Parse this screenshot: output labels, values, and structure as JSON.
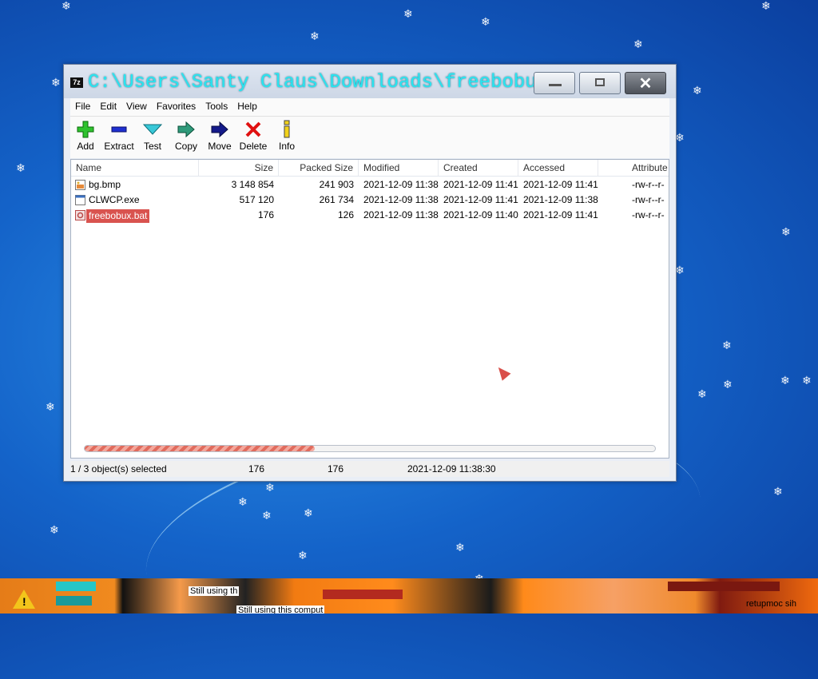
{
  "window": {
    "title": "C:\\Users\\Santy Claus\\Downloads\\freebobux-...",
    "app_icon_text": "7z"
  },
  "menu": [
    "File",
    "Edit",
    "View",
    "Favorites",
    "Tools",
    "Help"
  ],
  "toolbar": {
    "add": "Add",
    "extract": "Extract",
    "test": "Test",
    "copy": "Copy",
    "move": "Move",
    "delete": "Delete",
    "info": "Info"
  },
  "columns": {
    "name": "Name",
    "size": "Size",
    "packed": "Packed Size",
    "modified": "Modified",
    "created": "Created",
    "accessed": "Accessed",
    "attributes": "Attribute"
  },
  "files": [
    {
      "name": "bg.bmp",
      "size": "3 148 854",
      "packed": "241 903",
      "modified": "2021-12-09 11:38",
      "created": "2021-12-09 11:41",
      "accessed": "2021-12-09 11:41",
      "attributes": "-rw-r--r-"
    },
    {
      "name": "CLWCP.exe",
      "size": "517 120",
      "packed": "261 734",
      "modified": "2021-12-09 11:38",
      "created": "2021-12-09 11:41",
      "accessed": "2021-12-09 11:38",
      "attributes": "-rw-r--r-"
    },
    {
      "name": "freebobux.bat",
      "size": "176",
      "packed": "126",
      "modified": "2021-12-09 11:38",
      "created": "2021-12-09 11:40",
      "accessed": "2021-12-09 11:41",
      "attributes": "-rw-r--r-"
    }
  ],
  "status": {
    "selected": "1 / 3 object(s) selected",
    "size": "176",
    "packed": "176",
    "modified": "2021-12-09 11:38:30"
  },
  "taskbar": {
    "text1": "Still using th",
    "text2": "Still using this comput",
    "text3": "retupmoc sih"
  }
}
